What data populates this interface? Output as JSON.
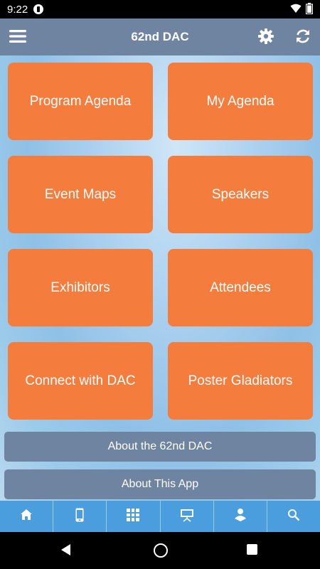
{
  "status_bar": {
    "time": "9:22"
  },
  "app_bar": {
    "title": "62nd DAC"
  },
  "tiles": [
    {
      "label": "Program Agenda"
    },
    {
      "label": "My Agenda"
    },
    {
      "label": "Event Maps"
    },
    {
      "label": "Speakers"
    },
    {
      "label": "Exhibitors"
    },
    {
      "label": "Attendees"
    },
    {
      "label": "Connect with DAC"
    },
    {
      "label": "Poster Gladiators"
    }
  ],
  "wide_buttons": [
    {
      "label": "About the 62nd DAC"
    },
    {
      "label": "About This App"
    }
  ],
  "tab_bar": {
    "icons": [
      "home-icon",
      "phone-icon",
      "qr-code-icon",
      "presentation-icon",
      "badge-user-icon",
      "search-icon"
    ]
  },
  "colors": {
    "tile": "#f47c3c",
    "app_bar": "#6f84a0",
    "tab_bar": "#4a9ede"
  }
}
